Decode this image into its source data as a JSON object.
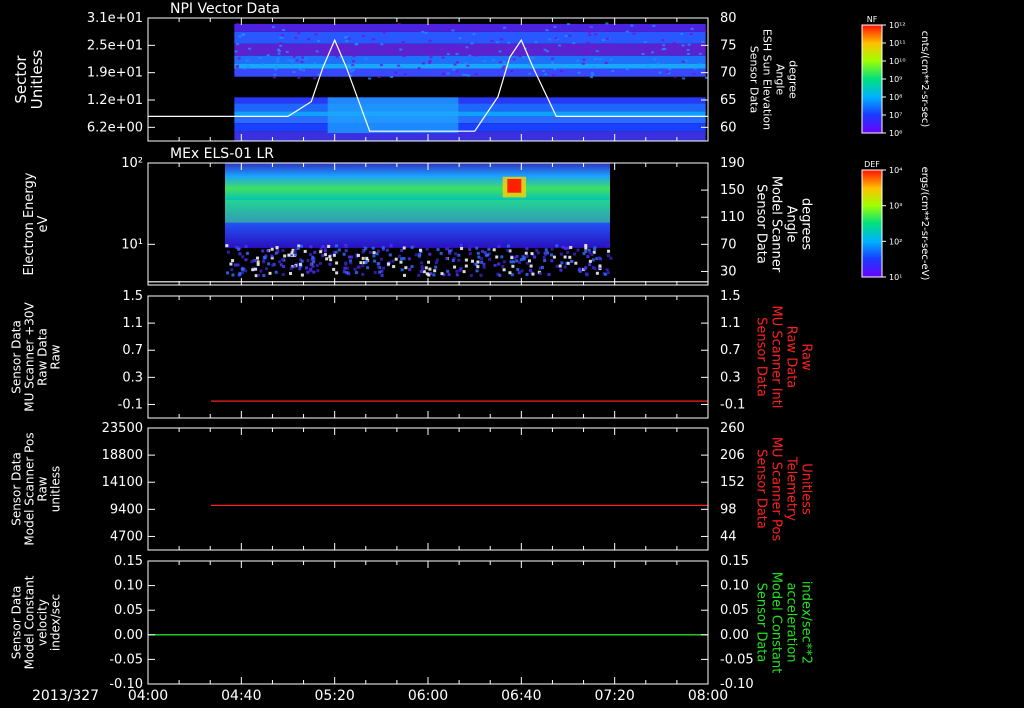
{
  "date_label": "2013/327",
  "time_ticks": [
    "04:00",
    "04:40",
    "05:20",
    "06:00",
    "06:40",
    "07:20",
    "08:00"
  ],
  "colors": {
    "background": "#000000",
    "axis": "#ffffff",
    "red_trace": "#ff2020",
    "green_trace": "#20e020"
  },
  "panels": [
    {
      "title": "NPI Vector Data",
      "ylabel_left": [
        "Sector",
        "Unitless"
      ],
      "yticks_left": [
        "3.1e+01",
        "2.5e+01",
        "1.9e+01",
        "1.2e+01",
        "6.2e+00"
      ],
      "ylabel_right": [
        "Sensor Data",
        "ESH Sun Elevation",
        "Angle",
        "degree"
      ],
      "yticks_right": [
        "80",
        "75",
        "70",
        "65",
        "60"
      ],
      "colorbar": {
        "label": "NF",
        "unit": "cnts/(cm**2-sr-sec)",
        "ticks": [
          "10¹²",
          "10¹¹",
          "10¹⁰",
          "10⁹",
          "10⁸",
          "10⁷",
          "10⁶"
        ]
      }
    },
    {
      "title": "MEx ELS-01 LR",
      "ylabel_left": [
        "Electron Energy",
        "eV"
      ],
      "yticks_left": [
        "10²",
        "10¹"
      ],
      "ylabel_right": [
        "Sensor Data",
        "Model Scanner",
        "Angle",
        "degrees"
      ],
      "yticks_right": [
        "190",
        "150",
        "110",
        "70",
        "30"
      ],
      "colorbar": {
        "label": "DEF",
        "unit": "ergs/(cm**2-sr-sec-eV)",
        "ticks": [
          "10⁴",
          "10³",
          "10²",
          "10¹"
        ]
      }
    },
    {
      "title": "",
      "ylabel_left": [
        "Sensor Data",
        "MU Scanner +30V",
        "Raw Data",
        "Raw"
      ],
      "yticks_left": [
        "1.5",
        "1.1",
        "0.7",
        "0.3",
        "-0.1"
      ],
      "ylabel_right": [
        "Sensor Data",
        "MU Scanner Intl",
        "Raw Data",
        "Raw"
      ],
      "yticks_right": [
        "1.5",
        "1.1",
        "0.7",
        "0.3",
        "-0.1"
      ]
    },
    {
      "title": "",
      "ylabel_left": [
        "Sensor Data",
        "Model Scanner Pos",
        "Raw",
        "unitless"
      ],
      "yticks_left": [
        "23500",
        "18800",
        "14100",
        "9400",
        "4700"
      ],
      "ylabel_right": [
        "Sensor Data",
        "MU Scanner Pos",
        "Telemetry",
        "Unitless"
      ],
      "yticks_right": [
        "260",
        "206",
        "152",
        "98",
        "44"
      ]
    },
    {
      "title": "",
      "ylabel_left": [
        "Sensor Data",
        "Model Constant",
        "velocity",
        "index/sec"
      ],
      "yticks_left": [
        "0.15",
        "0.10",
        "0.05",
        "0.00",
        "-0.05",
        "-0.10"
      ],
      "ylabel_right": [
        "Sensor Data",
        "Model Constant",
        "acceleration",
        "index/sec**2"
      ],
      "yticks_right": [
        "0.15",
        "0.10",
        "0.05",
        "0.00",
        "-0.05",
        "-0.10"
      ]
    }
  ],
  "chart_data": [
    {
      "type": "heatmap",
      "title": "NPI Vector Data",
      "ylabel": "Sector Unitless",
      "y_scale": "linear",
      "ylim": [
        0,
        31
      ],
      "x_range": [
        "04:00",
        "08:00"
      ],
      "data_coverage": [
        "04:37",
        "07:59"
      ],
      "colorbar": {
        "label": "NF",
        "scale": "log",
        "range": [
          1000000.0,
          1000000000000.0
        ]
      },
      "overlay_line": {
        "name": "Sensor Data ESH Sun Elevation Angle",
        "unit": "degree",
        "ylim": [
          55,
          80
        ],
        "x": [
          "04:00",
          "05:00",
          "05:10",
          "05:15",
          "05:20",
          "05:25",
          "05:35",
          "06:20",
          "06:30",
          "06:35",
          "06:40",
          "06:45",
          "06:55",
          "08:00"
        ],
        "values": [
          60,
          60,
          63,
          70,
          75.5,
          70,
          57,
          57,
          64,
          72,
          75.5,
          70,
          60,
          60
        ]
      }
    },
    {
      "type": "heatmap",
      "title": "MEx ELS-01 LR",
      "ylabel": "Electron Energy eV",
      "y_scale": "log",
      "ylim": [
        1,
        200
      ],
      "x_range": [
        "04:00",
        "08:00"
      ],
      "data_coverage": [
        "04:33",
        "07:18"
      ],
      "colorbar": {
        "label": "DEF",
        "scale": "log",
        "range": [
          10,
          10000
        ]
      },
      "overlay_line": {
        "name": "Sensor Data Model Scanner Angle",
        "unit": "degrees",
        "ylim": [
          0,
          190
        ],
        "x": [
          "04:00",
          "08:00"
        ],
        "values": [
          5,
          5
        ]
      }
    },
    {
      "type": "line",
      "xlim": [
        "04:00",
        "08:00"
      ],
      "ylim": [
        -0.3,
        1.5
      ],
      "series": [
        {
          "x": [
            "04:27",
            "08:00"
          ],
          "values": [
            -0.05,
            -0.05
          ],
          "color": "#ff2020"
        }
      ]
    },
    {
      "type": "line",
      "xlim": [
        "04:00",
        "08:00"
      ],
      "ylim": [
        0,
        23500
      ],
      "series": [
        {
          "x": [
            "04:27",
            "08:00"
          ],
          "values": [
            8600,
            8600
          ],
          "color": "#ff2020"
        }
      ]
    },
    {
      "type": "line",
      "xlim": [
        "04:00",
        "08:00"
      ],
      "ylim": [
        -0.1,
        0.15
      ],
      "series": [
        {
          "x": [
            "04:00",
            "08:00"
          ],
          "values": [
            0.0,
            0.0
          ],
          "color": "#20e020"
        }
      ]
    }
  ]
}
